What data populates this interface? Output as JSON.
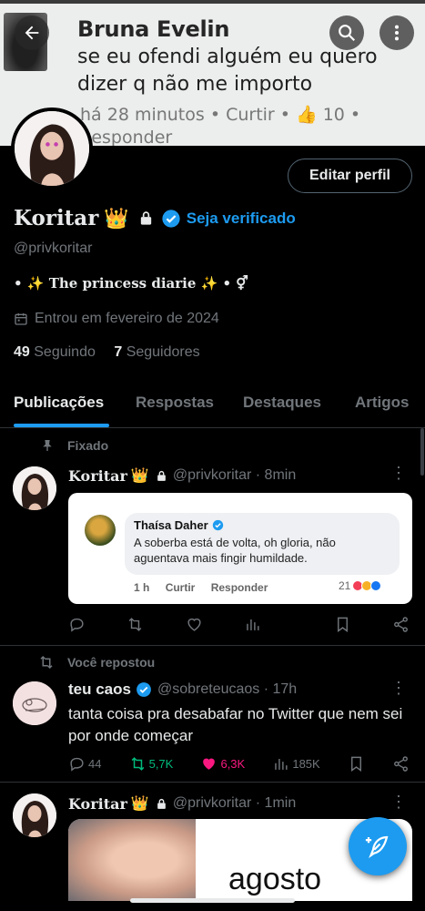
{
  "banner": {
    "name": "Bruna Evelin",
    "text": "se eu ofendi alguém eu quero dizer q não me importo",
    "meta": "há 28 minutos  •  Curtir  •  👍 10  •  Responder"
  },
  "header": {
    "back_icon": "arrow-left-icon",
    "search_icon": "search-icon",
    "more_icon": "more-vertical-icon"
  },
  "profile": {
    "edit_label": "Editar perfil",
    "name": "Koritar",
    "crown": "👑",
    "verify_label": "Seja verificado",
    "handle": "@privkoritar",
    "bio": "• ✨ The princess diarie ✨ • ⚥",
    "joined": "Entrou em fevereiro de 2024",
    "following_count": "49",
    "following_label": "Seguindo",
    "followers_count": "7",
    "followers_label": "Seguidores"
  },
  "tabs": [
    "Publicações",
    "Respostas",
    "Destaques",
    "Artigos"
  ],
  "tweet1": {
    "context": "Fixado",
    "name": "Koritar",
    "crown": "👑",
    "meta": "@privkoritar · 8min",
    "quote": {
      "name": "Thaísa Daher",
      "text": "A soberba está de volta, oh gloria, não aguentava mais fingir humildade.",
      "time": "1 h",
      "like": "Curtir",
      "reply": "Responder",
      "reactions": "21"
    }
  },
  "tweet2": {
    "context": "Você repostou",
    "name": "teu caos",
    "meta": "@sobreteucaos · 17h",
    "text": "tanta coisa pra desabafar no Twitter que nem sei por onde começar",
    "replies": "44",
    "reposts": "5,7K",
    "likes": "6,3K",
    "views": "185K"
  },
  "tweet3": {
    "name": "Koritar",
    "crown": "👑",
    "meta": "@privkoritar · 1min",
    "media_text": "agosto"
  },
  "colors": {
    "accent": "#1d9bf0",
    "repost": "#00ba7c",
    "like": "#f91880"
  }
}
